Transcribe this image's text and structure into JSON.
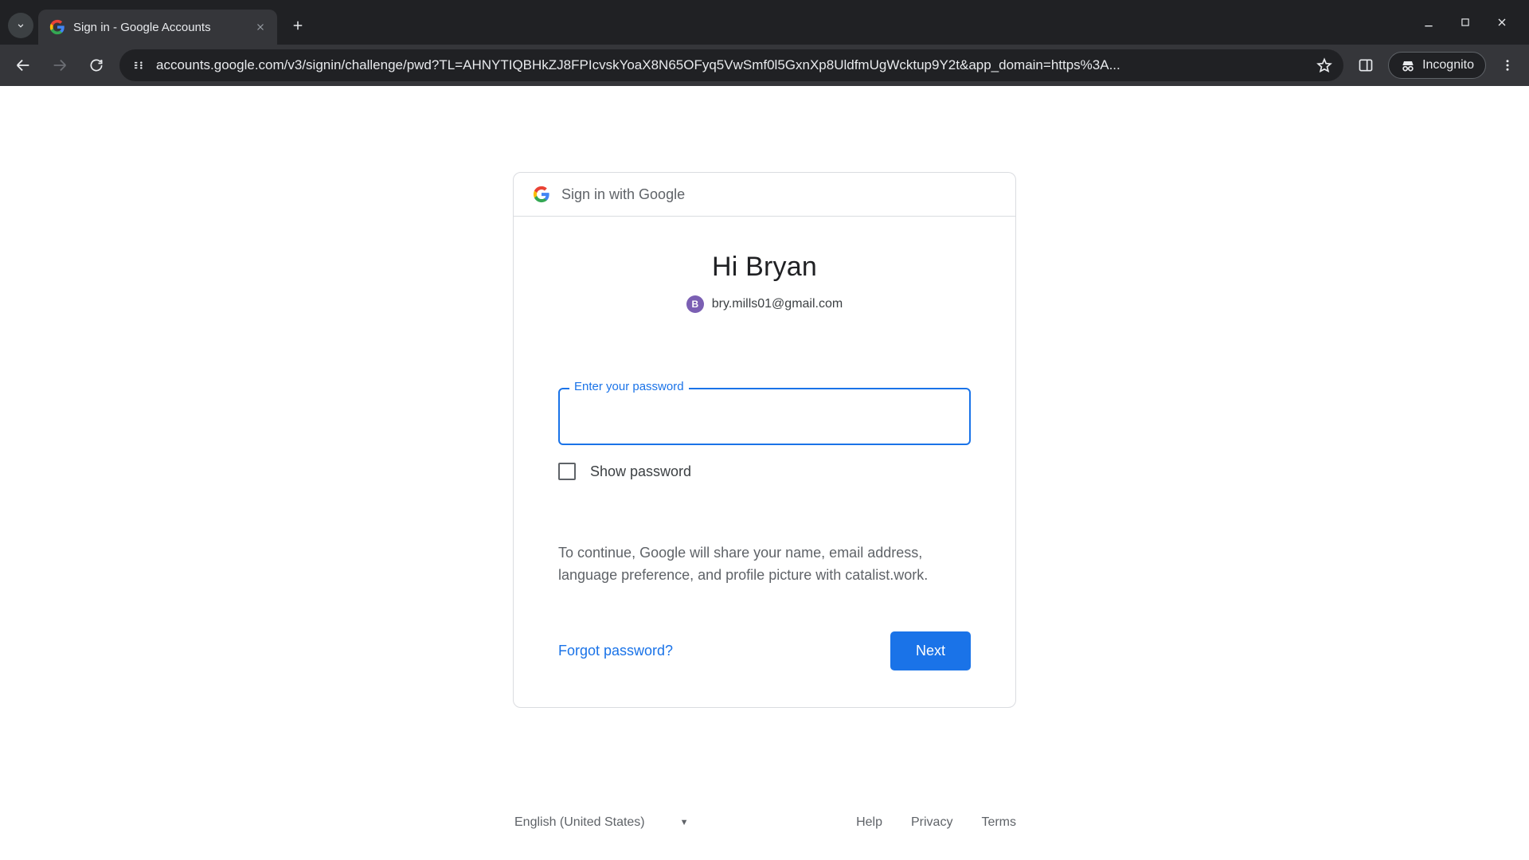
{
  "browser": {
    "tab_title": "Sign in - Google Accounts",
    "url": "accounts.google.com/v3/signin/challenge/pwd?TL=AHNYTIQBHkZJ8FPIcvskYoaX8N65OFyq5VwSmf0l5GxnXp8UldfmUgWcktup9Y2t&app_domain=https%3A...",
    "incognito_label": "Incognito"
  },
  "card": {
    "header": "Sign in with Google",
    "greeting": "Hi Bryan",
    "avatar_initial": "B",
    "email": "bry.mills01@gmail.com",
    "password_label": "Enter your password",
    "password_value": "",
    "show_password_label": "Show password",
    "disclosure": "To continue, Google will share your name, email address, language preference, and profile picture with catalist.work.",
    "forgot_label": "Forgot password?",
    "next_label": "Next"
  },
  "footer": {
    "language": "English (United States)",
    "links": {
      "help": "Help",
      "privacy": "Privacy",
      "terms": "Terms"
    }
  }
}
